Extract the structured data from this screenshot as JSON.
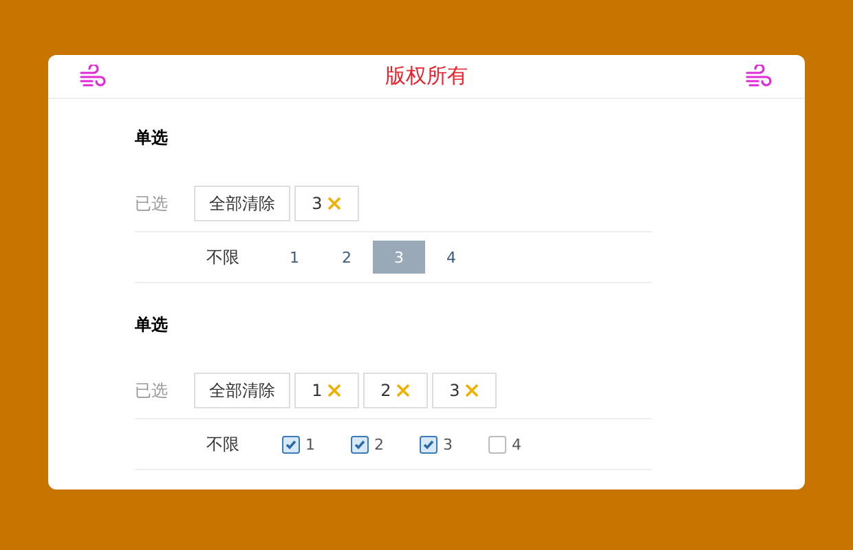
{
  "header": {
    "title": "版权所有"
  },
  "groups": [
    {
      "title": "单选",
      "kind": "radio",
      "selected_label": "已选",
      "clear_label": "全部清除",
      "chips": [
        "3"
      ],
      "any_label": "不限",
      "options": [
        {
          "label": "1",
          "selected": false
        },
        {
          "label": "2",
          "selected": false
        },
        {
          "label": "3",
          "selected": true
        },
        {
          "label": "4",
          "selected": false
        }
      ]
    },
    {
      "title": "单选",
      "kind": "checkbox",
      "selected_label": "已选",
      "clear_label": "全部清除",
      "chips": [
        "1",
        "2",
        "3"
      ],
      "any_label": "不限",
      "options": [
        {
          "label": "1",
          "checked": true
        },
        {
          "label": "2",
          "checked": true
        },
        {
          "label": "3",
          "checked": true
        },
        {
          "label": "4",
          "checked": false
        }
      ]
    }
  ]
}
